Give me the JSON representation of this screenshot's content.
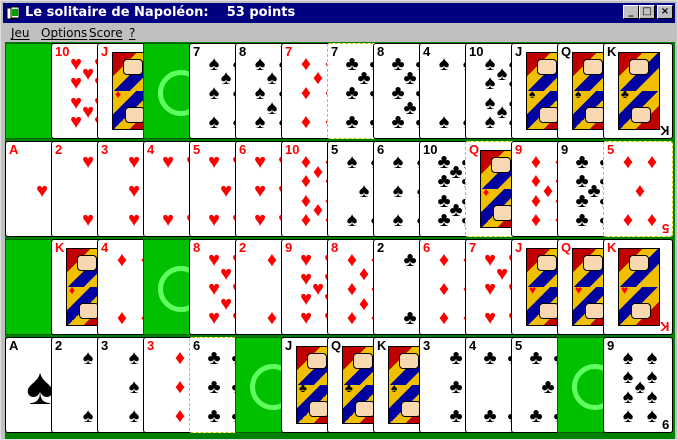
{
  "window": {
    "title": "Le solitaire de Napoléon:    53 points",
    "controls": [
      "_",
      "□",
      "×"
    ]
  },
  "menu": [
    "Jeu",
    "Options",
    "Score",
    "?"
  ],
  "colors": {
    "felt": "#007f00",
    "empty_slot": "#00c000",
    "ring": "#60ff60",
    "red_suit": "#ff0000",
    "title_bar": "#000080"
  },
  "rows": [
    [
      {
        "empty": true,
        "ring": false
      },
      {
        "rank": "10",
        "suit": "hearts"
      },
      {
        "rank": "J",
        "suit": "diamonds",
        "face": true
      },
      {
        "empty": true,
        "ring": true
      },
      {
        "rank": "7",
        "suit": "spades"
      },
      {
        "rank": "8",
        "suit": "spades"
      },
      {
        "rank": "7",
        "suit": "diamonds"
      },
      {
        "rank": "7",
        "suit": "clubs",
        "selected": true
      },
      {
        "rank": "8",
        "suit": "clubs"
      },
      {
        "rank": "4",
        "suit": "spades"
      },
      {
        "rank": "10",
        "suit": "spades"
      },
      {
        "rank": "J",
        "suit": "spades",
        "face": true
      },
      {
        "rank": "Q",
        "suit": "spades",
        "face": true
      },
      {
        "rank": "K",
        "suit": "clubs",
        "face": true,
        "wide": true
      }
    ],
    [
      {
        "rank": "A",
        "suit": "hearts"
      },
      {
        "rank": "2",
        "suit": "hearts"
      },
      {
        "rank": "3",
        "suit": "hearts"
      },
      {
        "rank": "4",
        "suit": "hearts"
      },
      {
        "rank": "5",
        "suit": "hearts"
      },
      {
        "rank": "6",
        "suit": "hearts"
      },
      {
        "rank": "10",
        "suit": "diamonds"
      },
      {
        "rank": "5",
        "suit": "spades"
      },
      {
        "rank": "6",
        "suit": "spades"
      },
      {
        "rank": "10",
        "suit": "clubs"
      },
      {
        "rank": "Q",
        "suit": "diamonds",
        "face": true,
        "selected": true
      },
      {
        "rank": "9",
        "suit": "diamonds"
      },
      {
        "rank": "9",
        "suit": "clubs"
      },
      {
        "rank": "5",
        "suit": "diamonds",
        "wide": true,
        "selected": true
      }
    ],
    [
      {
        "empty": true,
        "ring": false
      },
      {
        "rank": "K",
        "suit": "diamonds",
        "face": true
      },
      {
        "rank": "4",
        "suit": "diamonds"
      },
      {
        "empty": true,
        "ring": true
      },
      {
        "rank": "8",
        "suit": "hearts"
      },
      {
        "rank": "2",
        "suit": "diamonds"
      },
      {
        "rank": "9",
        "suit": "hearts"
      },
      {
        "rank": "8",
        "suit": "diamonds"
      },
      {
        "rank": "2",
        "suit": "clubs"
      },
      {
        "rank": "6",
        "suit": "diamonds"
      },
      {
        "rank": "7",
        "suit": "hearts"
      },
      {
        "rank": "J",
        "suit": "hearts",
        "face": true
      },
      {
        "rank": "Q",
        "suit": "hearts",
        "face": true
      },
      {
        "rank": "K",
        "suit": "hearts",
        "face": true,
        "wide": true
      }
    ],
    [
      {
        "rank": "A",
        "suit": "spades",
        "bigace": true
      },
      {
        "rank": "2",
        "suit": "spades"
      },
      {
        "rank": "3",
        "suit": "spades"
      },
      {
        "rank": "3",
        "suit": "diamonds"
      },
      {
        "rank": "6",
        "suit": "clubs",
        "selected": true
      },
      {
        "empty": true,
        "ring": true
      },
      {
        "rank": "J",
        "suit": "clubs",
        "face": true
      },
      {
        "rank": "Q",
        "suit": "clubs",
        "face": true
      },
      {
        "rank": "K",
        "suit": "spades",
        "face": true
      },
      {
        "rank": "3",
        "suit": "clubs"
      },
      {
        "rank": "4",
        "suit": "clubs"
      },
      {
        "rank": "5",
        "suit": "clubs"
      },
      {
        "empty": true,
        "ring": true
      },
      {
        "rank": "9",
        "suit": "spades",
        "wide": true
      }
    ]
  ]
}
